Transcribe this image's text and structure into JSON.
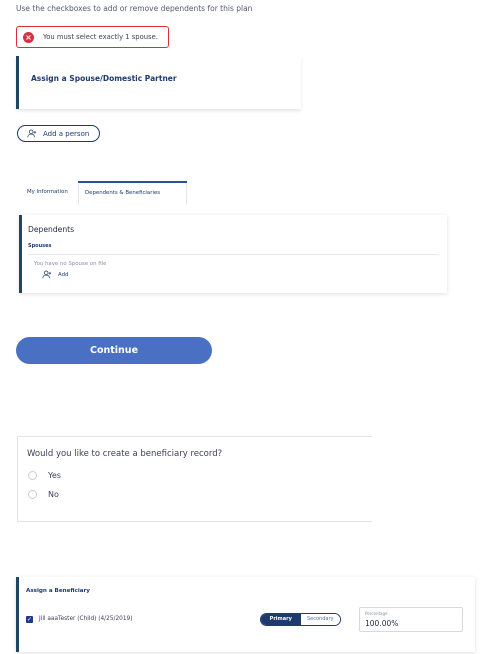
{
  "intro_text": "Use the checkboxes to add or remove dependents for this plan",
  "error": {
    "icon": "error-x-icon",
    "message": "You must select exactly 1 spouse."
  },
  "spouse_card": {
    "title": "Assign a Spouse/Domestic Partner"
  },
  "add_person": {
    "icon": "add-person-icon",
    "label": "Add a person"
  },
  "tabs": [
    {
      "label": "My Information",
      "active": false
    },
    {
      "label": "Dependents & Beneficiaries",
      "active": true
    }
  ],
  "dependents": {
    "title": "Dependents",
    "section": "Spouses",
    "empty_text": "You have no Spouse on file",
    "add_label": "Add"
  },
  "continue_label": "Continue",
  "beneficiary_question": {
    "title": "Would you like to create a beneficiary record?",
    "options": [
      {
        "label": "Yes",
        "selected": false
      },
      {
        "label": "No",
        "selected": false
      }
    ]
  },
  "assign_beneficiary": {
    "title": "Assign a Beneficiary",
    "person": {
      "checked": true,
      "name": "Jill aaaTester (Child) (4/25/2019)"
    },
    "toggle": {
      "primary": "Primary",
      "secondary": "Secondary",
      "selected": "Primary"
    },
    "percentage": {
      "label": "Percentage",
      "value": "100.00%"
    }
  },
  "colors": {
    "brand_navy": "#1e3a6e",
    "accent_blue": "#4a70c4",
    "error_red": "#d9303f"
  }
}
